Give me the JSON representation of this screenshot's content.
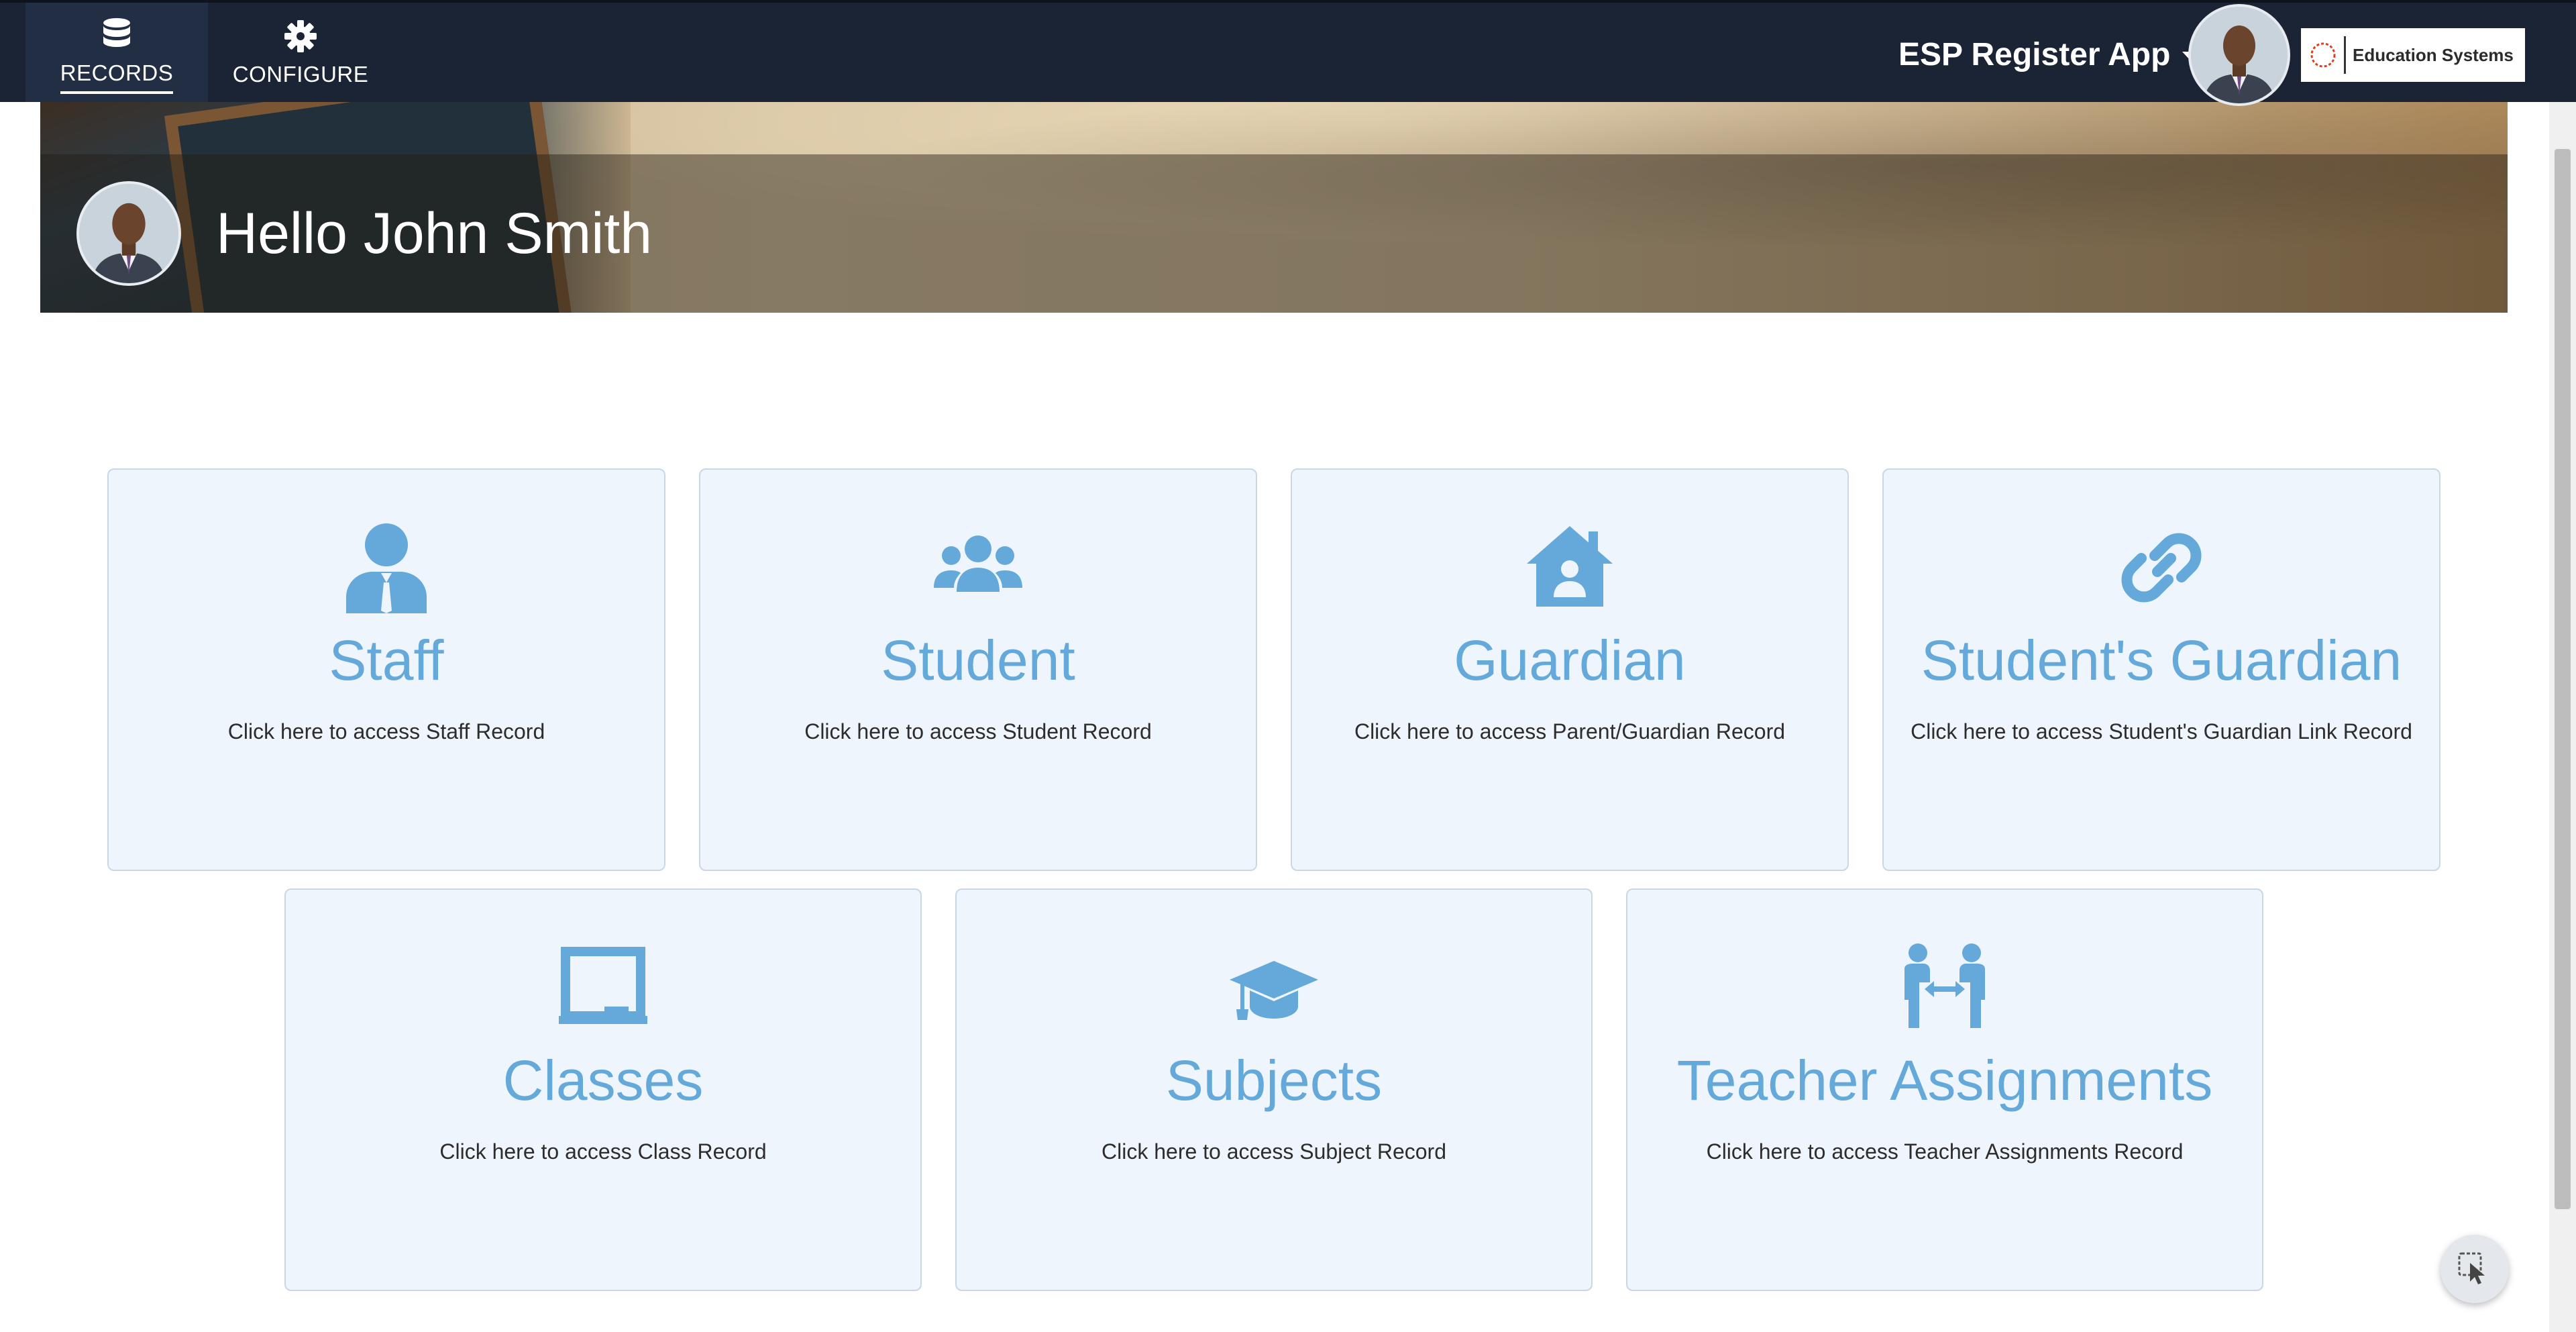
{
  "nav": {
    "records_label": "RECORDS",
    "configure_label": "CONFIGURE",
    "app_name": "ESP Register App",
    "logo_text": "Education Systems"
  },
  "hero": {
    "greeting": "Hello John Smith"
  },
  "tiles": [
    {
      "title": "Staff",
      "description": "Click here to access Staff Record",
      "icon": "user-tie-icon"
    },
    {
      "title": "Student",
      "description": "Click here to access Student Record",
      "icon": "users-icon"
    },
    {
      "title": "Guardian",
      "description": "Click here to access Parent/Guardian Record",
      "icon": "house-user-icon"
    },
    {
      "title": "Student's Guardian",
      "description": "Click here to access Student's Guardian Link Record",
      "icon": "link-icon"
    },
    {
      "title": "Classes",
      "description": "Click here to access Class Record",
      "icon": "chalkboard-icon"
    },
    {
      "title": "Subjects",
      "description": "Click here to access Subject Record",
      "icon": "graduation-cap-icon"
    },
    {
      "title": "Teacher Assignments",
      "description": "Click here to access Teacher Assignments Record",
      "icon": "people-arrows-icon"
    }
  ],
  "colors": {
    "nav_bg": "#1b2434",
    "tile_bg": "#eef5fc",
    "tile_accent": "#64a9d9"
  }
}
